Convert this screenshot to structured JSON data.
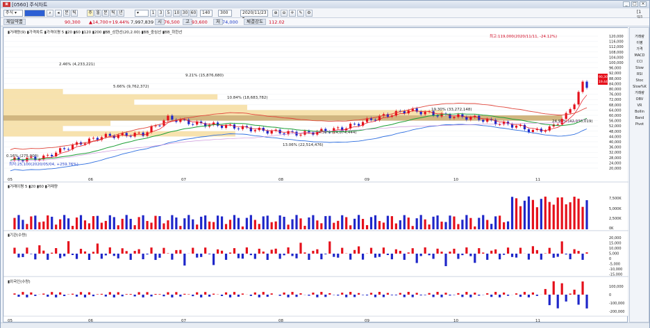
{
  "window": {
    "code": "0560",
    "title": "주식차트"
  },
  "toolbar": {
    "market": "주식",
    "stock_code": "",
    "period_buttons": [
      "분",
      "틱",
      "주",
      "월",
      "분",
      "틱",
      "년"
    ],
    "minute_buttons": [
      "1",
      "3",
      "5",
      "10",
      "30",
      "60"
    ],
    "count_value": "140",
    "count_total": "300",
    "date": "2020/11/23",
    "corner_label": "[1일]"
  },
  "info": {
    "stock_name": "제일약품",
    "price": "90,300",
    "change": "▲14,700",
    "change_rate": "+19.44%",
    "volume": "7,997,839",
    "high_label": "고",
    "high": "93,600",
    "low_label": "저",
    "low": "74,000",
    "open_label": "시",
    "open": "76,500",
    "strength_label": "체결강도",
    "strength": "112.02"
  },
  "legend_main": [
    "▮거래량(9)",
    "▮가격차트",
    "▮가격이평 5",
    "▮20",
    "▮60",
    "▮120",
    "▮200",
    "▮BB_상한선(20,2.00)",
    "▮BB_중심선",
    "▮BB_하한선"
  ],
  "legend_vol": [
    "▮거래이평 5",
    "▮20",
    "▮60",
    "▮거래량"
  ],
  "legend_inst": "▮기관(수량)",
  "legend_foreign": "▮외국인(수량)",
  "annotations": {
    "high_note": "최고:119,000(2020/11/11, -24.12%)",
    "low_note": "최저:25,100(2020/05/04, +259.76%)",
    "price_tag": "90,300",
    "change_tag": "19.44%"
  },
  "volume_profile": [
    {
      "label": "2.46% (4,233,221)"
    },
    {
      "label": "9.21% (15,876,680)"
    },
    {
      "label": "5.66% (9,762,372)"
    },
    {
      "label": "10.84% (18,683,782)"
    },
    {
      "label": "19.30% (33,272,148)"
    },
    {
      "label": "24.98% (42,930,019)"
    },
    {
      "label": "14.36% (24,874,444)"
    },
    {
      "label": "13.06% (22,514,476)"
    },
    {
      "label": "0.16% (275,000)"
    }
  ],
  "price_axis": [
    "120,000",
    "116,000",
    "112,000",
    "108,000",
    "104,000",
    "100,000",
    "96,000",
    "92,000",
    "88,000",
    "84,000",
    "80,000",
    "76,000",
    "72,000",
    "68,000",
    "64,000",
    "60,000",
    "56,000",
    "52,000",
    "48,000",
    "44,000",
    "40,000",
    "36,000",
    "32,000",
    "28,000",
    "24,000",
    "20,000"
  ],
  "volume_axis": [
    "7,500K",
    "5,000K",
    "2,500K",
    "0K"
  ],
  "inst_axis": [
    "20,000",
    "15,000",
    "10,000",
    "5,000",
    "0",
    "-5,000",
    "-10,000",
    "-15,000"
  ],
  "foreign_axis": [
    "100,000",
    "0",
    "-100,000",
    "-200,000"
  ],
  "x_axis": [
    "05",
    "06",
    "07",
    "08",
    "09",
    "10",
    "11"
  ],
  "sidebar": [
    "거래량",
    "이평",
    "가격",
    "MACD",
    "CCI",
    "Slow",
    "RSI",
    "Stoc",
    "Slow%K",
    "거래량",
    "OBV",
    "VR",
    "Bollin",
    "Band",
    "Pivot"
  ],
  "colors": {
    "up": "#e5101b",
    "down": "#1f27c9",
    "ma5": "#e5101b",
    "ma20": "#1b9f35",
    "bb_upper": "#e0453a",
    "bb_mid": "#1b9f35",
    "bb_lower": "#2d6ee0",
    "profile": "#f6dda0",
    "profile_hl": "#c9a96a"
  }
}
